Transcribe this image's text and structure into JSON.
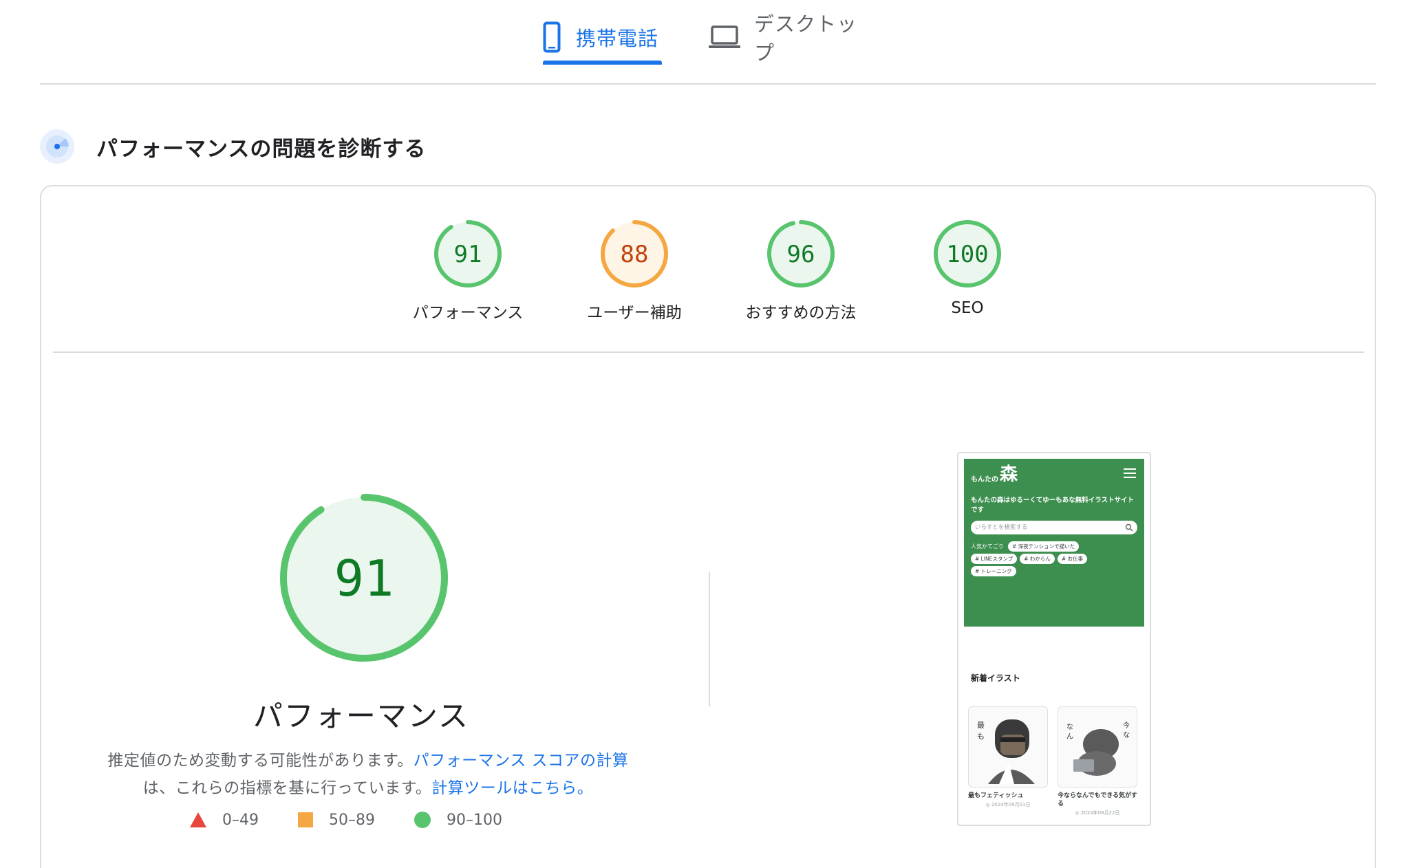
{
  "tabs": {
    "mobile": {
      "label": "携帯電話",
      "active": true
    },
    "desktop": {
      "label": "デスクトップ",
      "active": false
    }
  },
  "section": {
    "title": "パフォーマンスの問題を診断する"
  },
  "scores": [
    {
      "label": "パフォーマンス",
      "score": "91",
      "value": 91,
      "status": "pass"
    },
    {
      "label": "ユーザー補助",
      "score": "88",
      "value": 88,
      "status": "average"
    },
    {
      "label": "おすすめの方法",
      "score": "96",
      "value": 96,
      "status": "pass"
    },
    {
      "label": "SEO",
      "score": "100",
      "value": 100,
      "status": "pass"
    }
  ],
  "performance": {
    "score": "91",
    "value": 91,
    "title": "パフォーマンス",
    "desc_prefix": "推定値のため変動する可能性があります。",
    "desc_link1": "パフォーマンス スコアの計算",
    "desc_middle": "は、これらの指標を基に行っています。",
    "desc_link2": "計算ツールはこちら。"
  },
  "legend": [
    {
      "range": "0–49",
      "shape": "triangle",
      "color": "#e8453c"
    },
    {
      "range": "50–89",
      "shape": "square",
      "color": "#f5a742"
    },
    {
      "range": "90–100",
      "shape": "circle",
      "color": "#59c46e"
    }
  ],
  "colors": {
    "accent": "#1a73e8",
    "pass": "#59c46e",
    "pass_text": "#0f7a26",
    "pass_fill": "#ebf7ee",
    "average": "#f5a742",
    "average_text": "#c2410c",
    "average_fill": "#fff5e6"
  },
  "thumbnail": {
    "site_prefix": "もんたの",
    "site_big": "森",
    "tagline": "もんたの森はゆるーくてゆーもあな無料イラストサイトです",
    "search_placeholder": "いらすとを検索する",
    "popular_label": "人気かてごり",
    "tags": [
      "# 深夜テンションで描いた",
      "# LINEスタンプ",
      "# わからん",
      "# お仕事",
      "# トレーニング"
    ],
    "new_title": "新着イラスト",
    "posts": [
      {
        "title": "最もフェティッシュ",
        "date": "◎ 2024年09月01日"
      },
      {
        "title": "今ならなんでもできる気がする",
        "date": "◎ 2024年08月22日"
      }
    ]
  }
}
